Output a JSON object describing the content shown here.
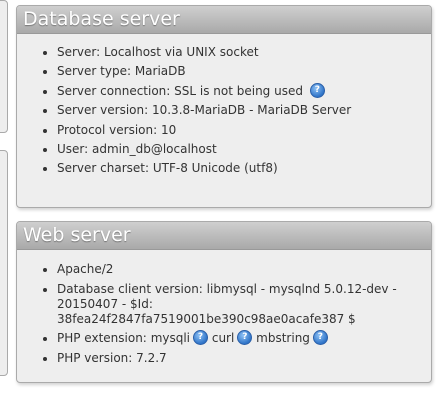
{
  "database_server": {
    "title": "Database server",
    "items": [
      "Server: Localhost via UNIX socket",
      "Server type: MariaDB",
      "Server connection: SSL is not being used",
      "Server version: 10.3.8-MariaDB - MariaDB Server",
      "Protocol version: 10",
      "User: admin_db@localhost",
      "Server charset: UTF-8 Unicode (utf8)"
    ]
  },
  "web_server": {
    "title": "Web server",
    "apache": "Apache/2",
    "db_client": "Database client version: libmysql - mysqlnd 5.0.12-dev - 20150407 - $Id: 38fea24f2847fa7519001be390c98ae0acafe387 $",
    "php_ext_label": "PHP extension:",
    "php_ext_1": "mysqli",
    "php_ext_2": "curl",
    "php_ext_3": "mbstring",
    "php_version": "PHP version: 7.2.7"
  },
  "icons": {
    "help": "help-icon",
    "help_glyph": "?"
  }
}
